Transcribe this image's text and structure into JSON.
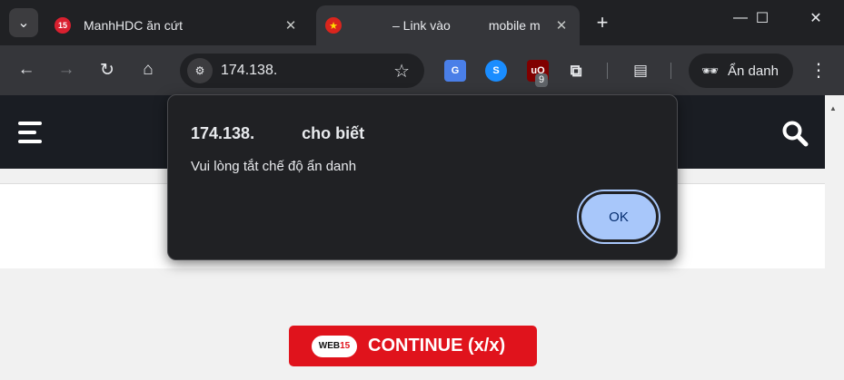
{
  "tabs": [
    {
      "title": "ManhHDC ăn cứt",
      "favicon": "15",
      "active": false
    },
    {
      "title_left": "",
      "title_mid": "– Link vào",
      "title_right": "mobile m",
      "favicon": "★",
      "active": true
    }
  ],
  "window_controls": {
    "minimize": "—",
    "maximize": "☐",
    "close": "✕"
  },
  "toolbar": {
    "url": "174.138.",
    "incognito_label": "Ẩn danh",
    "extension_badge": "9"
  },
  "page": {
    "continue_label": "CONTINUE (x/x)",
    "logo_text_a": "WEB",
    "logo_text_b": "15"
  },
  "dialog": {
    "origin": "174.138.",
    "says": "cho biết",
    "message": "Vui lòng tắt chế độ ẩn danh",
    "ok_label": "OK"
  },
  "colors": {
    "browser_bg": "#202124",
    "toolbar_bg": "#35363a",
    "ok_button": "#a8c7fa",
    "continue_button": "#e0131c",
    "site_header": "#1a1d23"
  }
}
